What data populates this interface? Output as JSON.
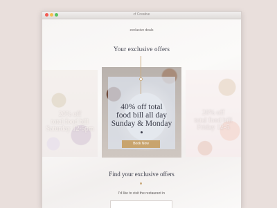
{
  "window": {
    "title": "cf Creative"
  },
  "page": {
    "subtitle": "exclusive deals",
    "heading": "Your exclusive offers",
    "find_heading": "Find your exclusive  offers",
    "visit_label": "I'd like to visit the restaurant in"
  },
  "offers": [
    {
      "lines": [
        "20% off",
        "total food bill",
        "Saturday 12-5pm"
      ]
    },
    {
      "lines": [
        "40% off total",
        "food bill all day",
        "Sunday & Monday"
      ],
      "button": "Book Now"
    },
    {
      "lines": [
        "20% off",
        "total food bill",
        "Friday 12-5"
      ]
    }
  ],
  "colors": {
    "accent": "#c8a46e",
    "text": "#3b3d4a",
    "background": "#e9dfdc"
  }
}
